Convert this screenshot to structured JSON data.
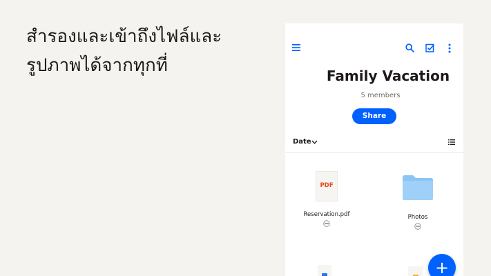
{
  "headline": "สำรองและเข้าถึงไฟล์และรูปภาพได้จากทุกที่",
  "folder": {
    "title": "Family Vacation",
    "members": "5 members",
    "share_label": "Share"
  },
  "sort": {
    "label": "Date"
  },
  "files": [
    {
      "name": "Reservation.pdf",
      "thumb_label": "PDF",
      "type": "pdf"
    },
    {
      "name": "Photos",
      "type": "folder"
    }
  ],
  "fab_label": "+",
  "icons": [
    "menu-icon",
    "search-icon",
    "select-icon",
    "more-vertical-icon",
    "chevron-down-icon",
    "list-view-icon",
    "more-horizontal-icon",
    "plus-icon"
  ],
  "colors": {
    "accent": "#0061fe",
    "folder": "#8cc4f5",
    "pdf": "#e8481a",
    "background": "#f5f3ef"
  }
}
